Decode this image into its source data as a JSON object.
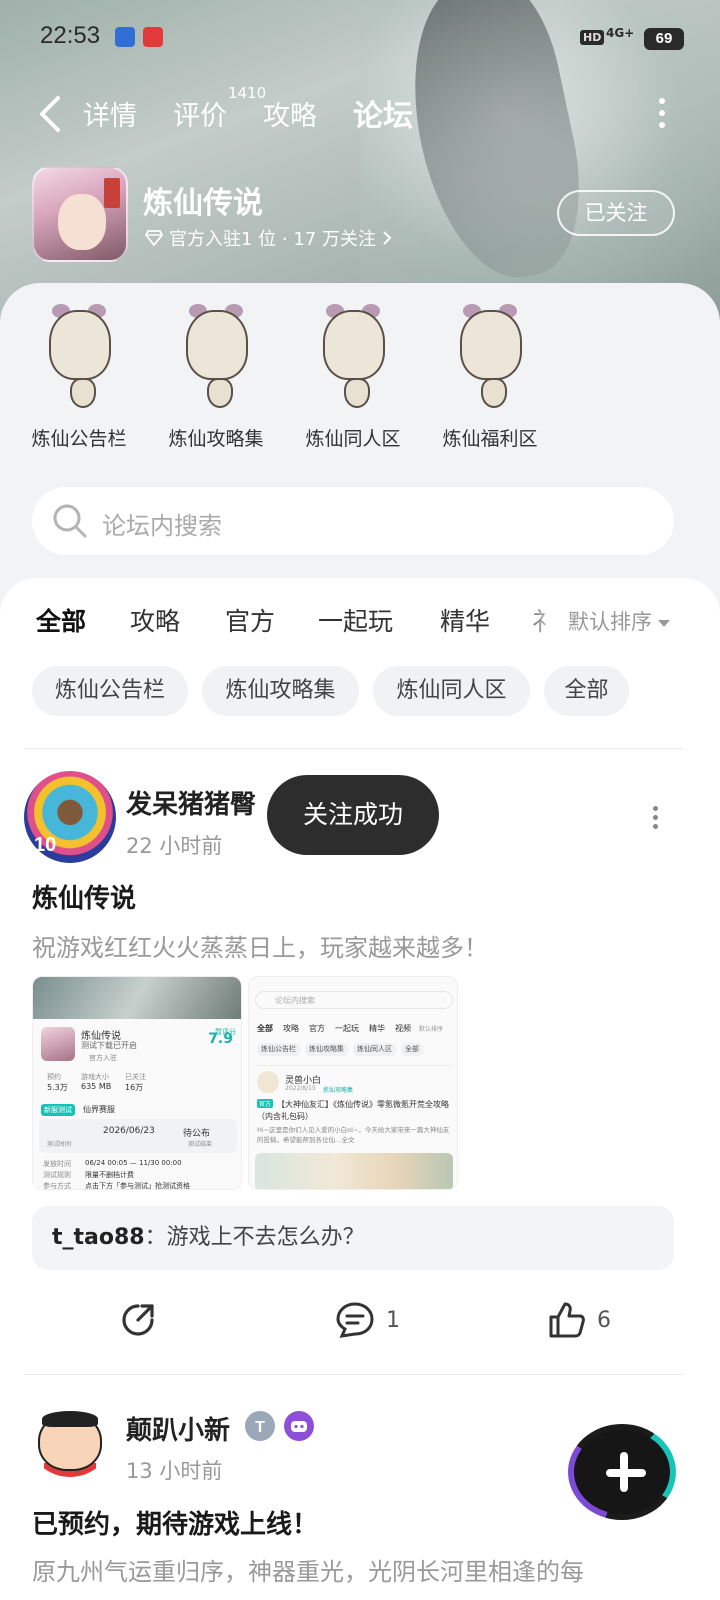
{
  "status_bar": {
    "time": "22:53",
    "hd": "HD",
    "signal": "4G+",
    "battery": "69"
  },
  "nav": {
    "tabs": [
      "详情",
      "评价",
      "攻略",
      "论坛"
    ],
    "active_tab": "论坛",
    "review_count": "1410"
  },
  "game": {
    "name": "炼仙传说",
    "meta": "官方入驻1 位 · 17 万关注",
    "follow_label": "已关注"
  },
  "subforums": [
    {
      "label": "炼仙公告栏"
    },
    {
      "label": "炼仙攻略集"
    },
    {
      "label": "炼仙同人区"
    },
    {
      "label": "炼仙福利区"
    }
  ],
  "search": {
    "placeholder": "论坛内搜索"
  },
  "feed_tabs": [
    "全部",
    "攻略",
    "官方",
    "一起玩",
    "精华",
    "礻"
  ],
  "sort_label": "默认排序",
  "chips": [
    "炼仙公告栏",
    "炼仙攻略集",
    "炼仙同人区",
    "全部"
  ],
  "toast": "关注成功",
  "post1": {
    "author": "发呆猪猪臀",
    "avatar_badge": "10",
    "time": "22 小时前",
    "title": "炼仙传说",
    "body": "祝游戏红红火火蒸蒸日上，玩家越来越多！",
    "thumb1": {
      "name": "炼仙传说",
      "subtitle": "测试下载已开启",
      "official": "官方入驻",
      "score_label": "暂评分",
      "score": "7.9",
      "stats": [
        "预约",
        "5.3万",
        "游戏大小",
        "635 MB",
        "已关注",
        "16万"
      ],
      "section": "新服测试",
      "server": "仙界赛服",
      "test_time_label": "测试时间",
      "date": "2026/06/23",
      "status": "待公布",
      "test_end": "测试结束",
      "rows": [
        [
          "发放时间",
          "06/24 00:05 — 11/30 00:00"
        ],
        [
          "测试规则",
          "限量不删档计费"
        ],
        [
          "参与方式",
          "点击下方「参与测试」抢测试资格"
        ]
      ]
    },
    "thumb2": {
      "search": "论坛内搜索",
      "tabs": [
        "全部",
        "攻略",
        "官方",
        "一起玩",
        "精华",
        "视频",
        "默认排序"
      ],
      "chips": [
        "炼仙公告栏",
        "炼仙攻略集",
        "炼仙同人区",
        "全部"
      ],
      "author": "灵兽小白",
      "date": "2022/8/15",
      "board": "炼仙攻略集",
      "tag": "官方",
      "title": "【大神仙友汇】《炼仙传说》零氪微氪开荒全攻略（内含礼包码）",
      "excerpt": "Hi~这里是你们人见人爱的小白ol~，今天给大家带来一篇大神仙友的投稿，希望能帮到各位仙…全文"
    },
    "comment_user": "t_tao88",
    "comment_text": "游戏上不去怎么办？",
    "comment_count": "1",
    "like_count": "6"
  },
  "post2": {
    "author": "颠趴小新",
    "time": "13 小时前",
    "title": "已预约，期待游戏上线！",
    "body": "原九州气运重归序，神器重光，光阴长河里相逢的每"
  },
  "colors": {
    "accent": "#16c2b6",
    "toast_bg": "#2d2d2d",
    "badge_purple": "#8c4fd6"
  }
}
